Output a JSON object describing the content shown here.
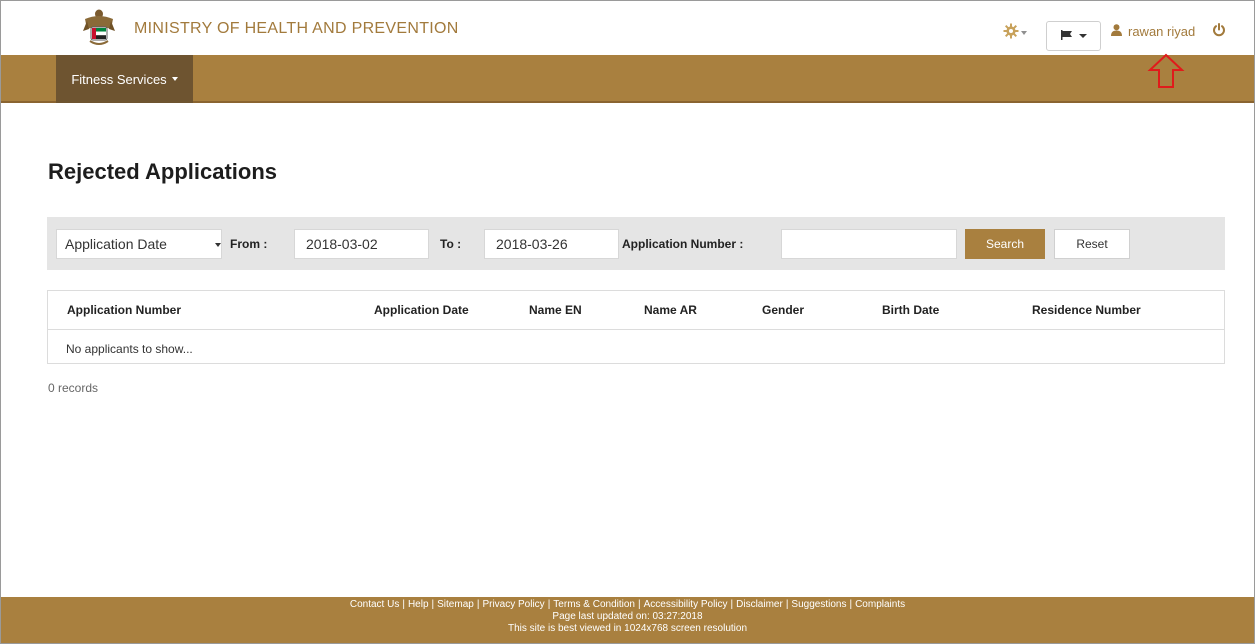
{
  "header": {
    "title": "MINISTRY OF HEALTH AND PREVENTION",
    "user_name": "rawan riyad",
    "icons": {
      "emblem": "emblem-icon",
      "settings": "gear-icon",
      "flag": "flag-icon",
      "user": "user-icon",
      "logout": "power-icon"
    },
    "brand_color": "#a27a3c"
  },
  "navbar": {
    "items": [
      {
        "label": "Fitness Services"
      }
    ],
    "bg_color": "#a9803f",
    "active_color": "#6e5430"
  },
  "page": {
    "title": "Rejected Applications"
  },
  "filters": {
    "date_type": "Application Date",
    "from_label": "From :",
    "from_value": "2018-03-02",
    "to_label": "To :",
    "to_value": "2018-03-26",
    "app_number_label": "Application Number :",
    "app_number_value": "",
    "search_label": "Search",
    "reset_label": "Reset"
  },
  "table": {
    "columns": [
      "Application Number",
      "Application Date",
      "Name EN",
      "Name AR",
      "Gender",
      "Birth Date",
      "Residence Number"
    ],
    "empty_message": "No applicants to show..."
  },
  "records": "0 records",
  "footer": {
    "links": [
      "Contact Us",
      "Help",
      "Sitemap",
      "Privacy Policy",
      "Terms & Condition",
      "Accessibility Policy",
      "Disclaimer",
      "Suggestions",
      "Complaints"
    ],
    "last_updated": "Page last updated on: 03:27:2018",
    "resolution_note": "This site is best viewed in 1024x768 screen resolution"
  }
}
